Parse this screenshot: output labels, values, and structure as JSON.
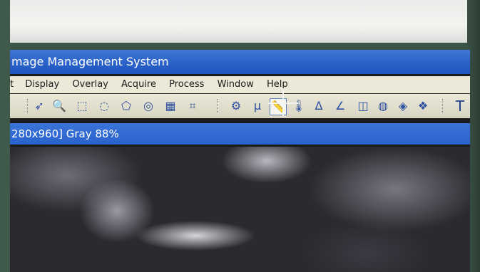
{
  "window": {
    "title": "mage Management System"
  },
  "menu": {
    "items": [
      "t",
      "Display",
      "Overlay",
      "Acquire",
      "Process",
      "Window",
      "Help"
    ]
  },
  "toolbar": {
    "tools": [
      {
        "name": "select-arrow-icon",
        "glyph": "➶"
      },
      {
        "name": "zoom-icon",
        "glyph": "🔍"
      },
      {
        "name": "rect-select-icon",
        "glyph": "⬚"
      },
      {
        "name": "ellipse-select-icon",
        "glyph": "◌"
      },
      {
        "name": "polygon-select-icon",
        "glyph": "⬠"
      },
      {
        "name": "freehand-select-icon",
        "glyph": "◎"
      },
      {
        "name": "magic-rect-icon",
        "glyph": "▦"
      },
      {
        "name": "crop-icon",
        "glyph": "⌗"
      },
      {
        "name": "calibrate-icon",
        "glyph": "⚙"
      },
      {
        "name": "micron-icon",
        "glyph": "μ"
      },
      {
        "name": "ruler-icon",
        "glyph": "📏"
      },
      {
        "name": "thermometer-icon",
        "glyph": "🌡"
      },
      {
        "name": "angle-icon",
        "glyph": "∆"
      },
      {
        "name": "multi-angle-icon",
        "glyph": "∠"
      },
      {
        "name": "area-icon",
        "glyph": "◫"
      },
      {
        "name": "circle-measure-icon",
        "glyph": "◍"
      },
      {
        "name": "count-icon",
        "glyph": "◈"
      },
      {
        "name": "cluster-icon",
        "glyph": "❖"
      },
      {
        "name": "text-icon",
        "glyph": "T"
      }
    ]
  },
  "status": {
    "text": "280x960] Gray 88%"
  },
  "colors": {
    "titlebar": "#2b62c8",
    "menubar": "#ece9d8",
    "status": "#2962cc"
  }
}
